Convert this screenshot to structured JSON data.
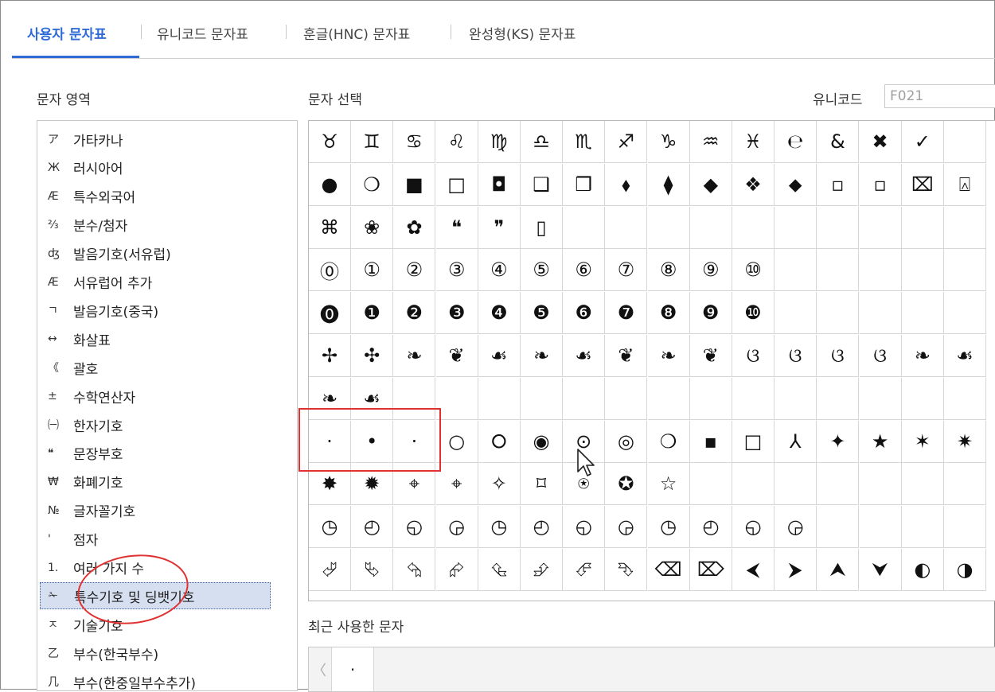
{
  "tabs": [
    {
      "label": "사용자 문자표",
      "active": true
    },
    {
      "label": "유니코드 문자표",
      "active": false
    },
    {
      "label": "훈글(HNC) 문자표",
      "active": false
    },
    {
      "label": "완성형(KS) 문자표",
      "active": false
    }
  ],
  "left": {
    "title": "문자 영역",
    "items": [
      {
        "icon": "ア",
        "label": "가타카나"
      },
      {
        "icon": "Ж",
        "label": "러시아어"
      },
      {
        "icon": "Æ",
        "label": "특수외국어"
      },
      {
        "icon": "⅔",
        "label": "분수/첨자"
      },
      {
        "icon": "ʤ",
        "label": "발음기호(서유럽)"
      },
      {
        "icon": "Æ",
        "label": "서유럽어 추가"
      },
      {
        "icon": "ㄱ",
        "label": "발음기호(중국)"
      },
      {
        "icon": "↔",
        "label": "화살표"
      },
      {
        "icon": "《",
        "label": "괄호"
      },
      {
        "icon": "±",
        "label": "수학연산자"
      },
      {
        "icon": "㈠",
        "label": "한자기호"
      },
      {
        "icon": "❝",
        "label": "문장부호"
      },
      {
        "icon": "₩",
        "label": "화폐기호"
      },
      {
        "icon": "№",
        "label": "글자꼴기호"
      },
      {
        "icon": "'",
        "label": "점자"
      },
      {
        "icon": "1.",
        "label": "여러 가지 수"
      },
      {
        "icon": "✁",
        "label": "특수기호 및 딩뱃기호",
        "selected": true
      },
      {
        "icon": "ㅈ",
        "label": "기술기호"
      },
      {
        "icon": "乙",
        "label": "부수(한국부수)"
      },
      {
        "icon": "几",
        "label": "부수(한중일부수추가)"
      }
    ]
  },
  "right": {
    "title": "문자 선택",
    "unicode_label": "유니코드",
    "unicode_value": "F021"
  },
  "grid": {
    "rows": [
      [
        "♉",
        "♊",
        "♋",
        "♌",
        "♍",
        "♎",
        "♏",
        "♐",
        "♑",
        "♒",
        "♓",
        "℮",
        "&",
        "✖",
        "✓"
      ],
      [
        "●",
        "❍",
        "■",
        "□",
        "◘",
        "❑",
        "❒",
        "⬧",
        "⧫",
        "◆",
        "❖",
        "⬥",
        "▫",
        "▫",
        "⌧",
        "⍓"
      ],
      [
        "⌘",
        "❀",
        "✿",
        "❝",
        "❞",
        "▯"
      ],
      [
        "⓪",
        "①",
        "②",
        "③",
        "④",
        "⑤",
        "⑥",
        "⑦",
        "⑧",
        "⑨",
        "⑩"
      ],
      [
        "⓿",
        "❶",
        "❷",
        "❸",
        "❹",
        "❺",
        "❻",
        "❼",
        "❽",
        "❾",
        "❿"
      ],
      [
        "✢",
        "✣",
        "❧",
        "❦",
        "☙",
        "❧",
        "☙",
        "❦",
        "❧",
        "❦",
        "ଓ",
        "ଓ",
        "ଓ",
        "ଓ",
        "❧",
        "☙"
      ],
      [
        "❧",
        "☙"
      ],
      [
        "·",
        "•",
        "·",
        "○",
        "⭘",
        "◉",
        "⊙",
        "◎",
        "❍",
        "▪",
        "□",
        "⅄",
        "✦",
        "★",
        "✶",
        "✷"
      ],
      [
        "✸",
        "✹",
        "⌖",
        "⌖",
        "✧",
        "⌑",
        "⍟",
        "✪",
        "☆"
      ],
      [
        "◷",
        "◴",
        "◵",
        "◶",
        "◷",
        "◴",
        "◵",
        "◶",
        "◷",
        "◴",
        "◵",
        "◶"
      ],
      [
        "⮰",
        "⮱",
        "⮲",
        "⮳",
        "⮴",
        "⮵",
        "⮶",
        "⮷",
        "⌫",
        "⌦",
        "⮜",
        "⮞",
        "⮝",
        "⮟",
        "◐",
        "◑"
      ]
    ]
  },
  "recent": {
    "title": "최근 사용한 문자",
    "left_arrow": "〈",
    "chars": [
      "·"
    ]
  }
}
